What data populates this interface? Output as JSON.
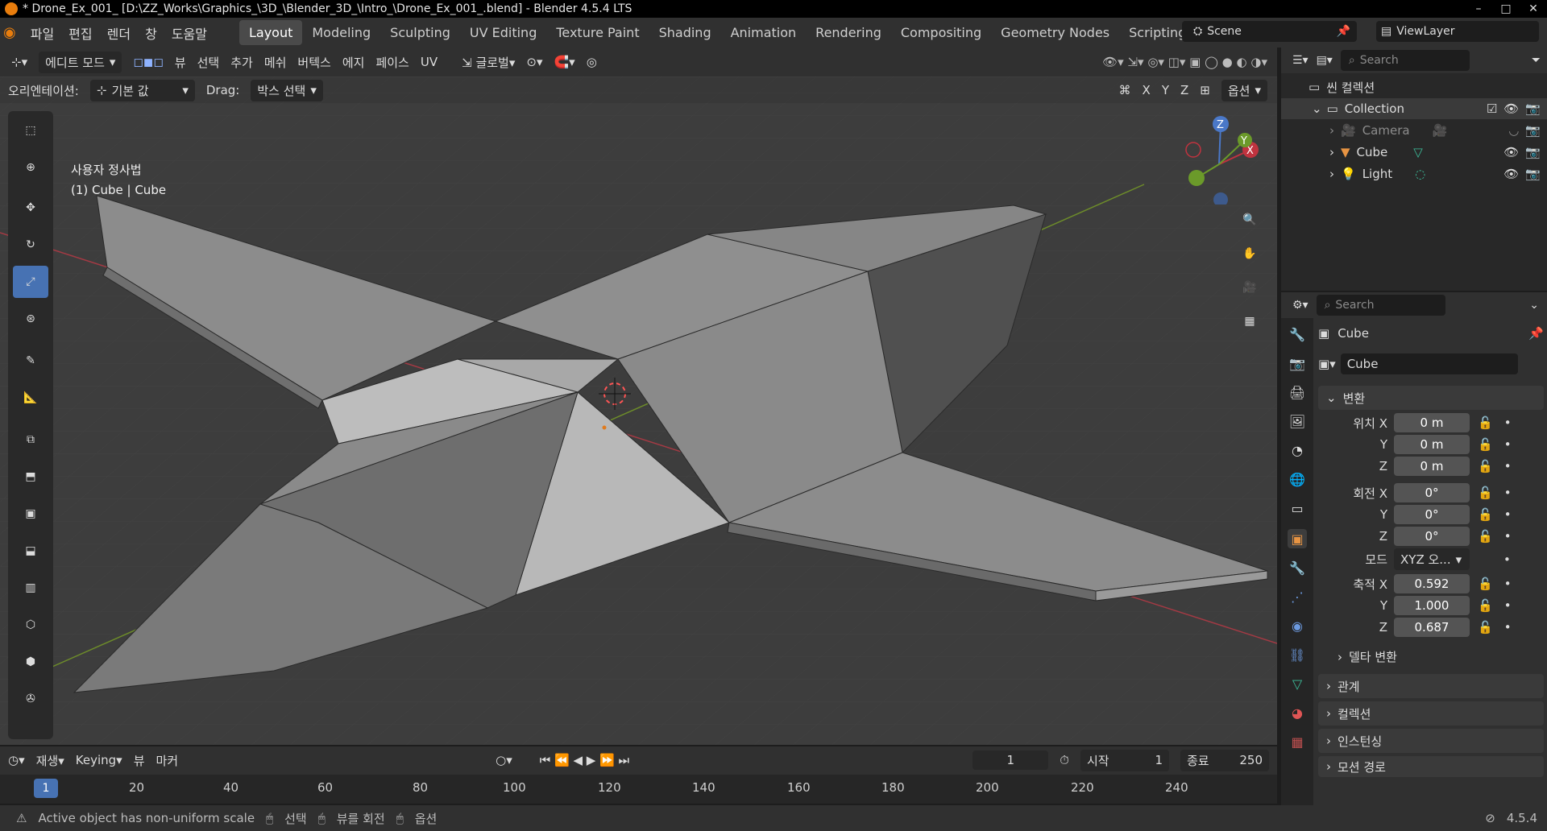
{
  "titlebar": {
    "title": "* Drone_Ex_001_ [D:\\ZZ_Works\\Graphics_\\3D_\\Blender_3D_\\Intro_\\Drone_Ex_001_.blend] - Blender 4.5.4 LTS"
  },
  "menu": {
    "file": "파일",
    "edit": "편집",
    "render": "렌더",
    "window": "창",
    "help": "도움말"
  },
  "workspaces": [
    "Layout",
    "Modeling",
    "Sculpting",
    "UV Editing",
    "Texture Paint",
    "Shading",
    "Animation",
    "Rendering",
    "Compositing",
    "Geometry Nodes",
    "Scripting"
  ],
  "scene": {
    "name": "Scene"
  },
  "viewlayer": {
    "name": "ViewLayer"
  },
  "viewport": {
    "mode": "에디트 모드",
    "menus": [
      "뷰",
      "선택",
      "추가",
      "메쉬",
      "버텍스",
      "에지",
      "페이스",
      "UV"
    ],
    "transform_space": "글로벌",
    "orientation_label": "오리엔테이션:",
    "orientation_value": "기본 값",
    "drag_label": "Drag:",
    "drag_value": "박스 선택",
    "options": "옵션",
    "axis_x": "X",
    "axis_y": "Y",
    "axis_z": "Z",
    "view_name": "사용자 정사법",
    "object_info": "(1) Cube | Cube",
    "gizmo": {
      "x": "X",
      "y": "Y",
      "z": "Z"
    }
  },
  "outliner": {
    "search_placeholder": "Search",
    "scene_collection": "씬 컬렉션",
    "collection": "Collection",
    "items": [
      "Camera",
      "Cube",
      "Light"
    ]
  },
  "properties": {
    "search_placeholder": "Search",
    "object_name": "Cube",
    "object_field": "Cube",
    "transform_title": "변환",
    "location_label": "위치 X",
    "rotation_label": "회전 X",
    "scale_label": "축적 X",
    "y_label": "Y",
    "z_label": "Z",
    "location": [
      "0 m",
      "0 m",
      "0 m"
    ],
    "rotation": [
      "0°",
      "0°",
      "0°"
    ],
    "mode_label": "모드",
    "mode_value": "XYZ 오...",
    "scale": [
      "0.592",
      "1.000",
      "0.687"
    ],
    "delta_transform": "델타 변환",
    "relations": "관계",
    "collections": "컬렉션",
    "instancing": "인스턴싱",
    "motion_paths": "모션 경로"
  },
  "timeline": {
    "playback": "재생",
    "keying": "Keying",
    "view": "뷰",
    "marker": "마커",
    "current_frame": "1",
    "start_label": "시작",
    "start_value": "1",
    "end_label": "종료",
    "end_value": "250",
    "ruler": [
      "1",
      "20",
      "40",
      "60",
      "80",
      "100",
      "120",
      "140",
      "160",
      "180",
      "200",
      "220",
      "240"
    ]
  },
  "statusbar": {
    "warning": "Active object has non-uniform scale",
    "select": "선택",
    "rotate_view": "뷰를 회전",
    "options": "옵션",
    "version": "4.5.4"
  }
}
